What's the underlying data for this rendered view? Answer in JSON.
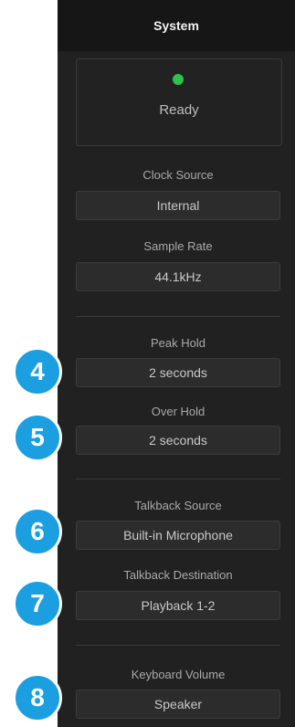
{
  "panel": {
    "title": "System",
    "status": {
      "text": "Ready",
      "color": "#2ec24a"
    }
  },
  "settings": {
    "clock_source": {
      "label": "Clock Source",
      "value": "Internal"
    },
    "sample_rate": {
      "label": "Sample Rate",
      "value": "44.1kHz"
    },
    "peak_hold": {
      "label": "Peak Hold",
      "value": "2 seconds"
    },
    "over_hold": {
      "label": "Over Hold",
      "value": "2 seconds"
    },
    "talkback_source": {
      "label": "Talkback Source",
      "value": "Built-in Microphone"
    },
    "talkback_destination": {
      "label": "Talkback Destination",
      "value": "Playback 1-2"
    },
    "keyboard_volume": {
      "label": "Keyboard Volume",
      "value": "Speaker"
    }
  },
  "callouts": [
    "4",
    "5",
    "6",
    "7",
    "8"
  ],
  "colors": {
    "accent_badge": "#1b9fe0",
    "panel_bg": "#212121",
    "header_bg": "#161616"
  }
}
